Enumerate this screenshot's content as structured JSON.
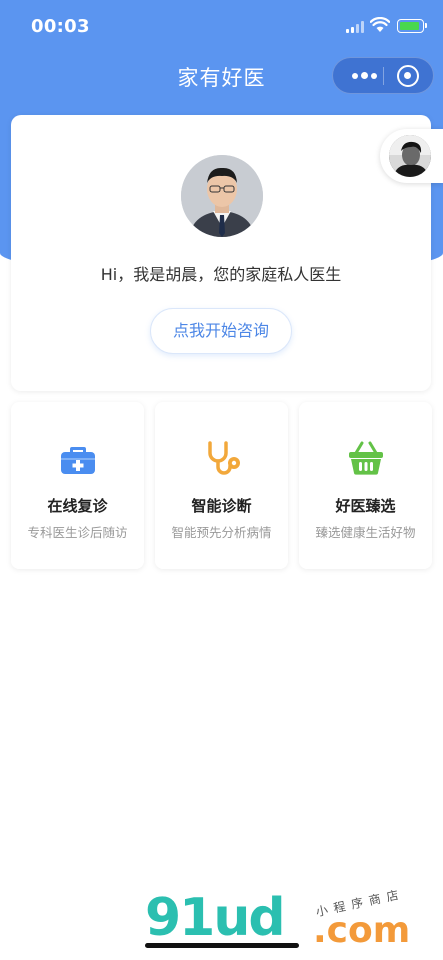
{
  "status_bar": {
    "time": "00:03"
  },
  "header": {
    "title": "家有好医"
  },
  "doctor_card": {
    "greeting": "Hi，我是胡晨，您的家庭私人医生",
    "consult_button": "点我开始咨询"
  },
  "services": [
    {
      "title": "在线复诊",
      "subtitle": "专科医生诊后随访",
      "icon": "medical-kit-icon",
      "color": "#4a8df0"
    },
    {
      "title": "智能诊断",
      "subtitle": "智能预先分析病情",
      "icon": "stethoscope-icon",
      "color": "#f2a83b"
    },
    {
      "title": "好医臻选",
      "subtitle": "臻选健康生活好物",
      "icon": "basket-icon",
      "color": "#63c247"
    }
  ],
  "watermark": {
    "brand": "91ud",
    "suffix": ".com",
    "tagline": "小程序商店"
  },
  "colors": {
    "header_bg": "#5b95f0",
    "accent_text": "#4d87e6"
  }
}
